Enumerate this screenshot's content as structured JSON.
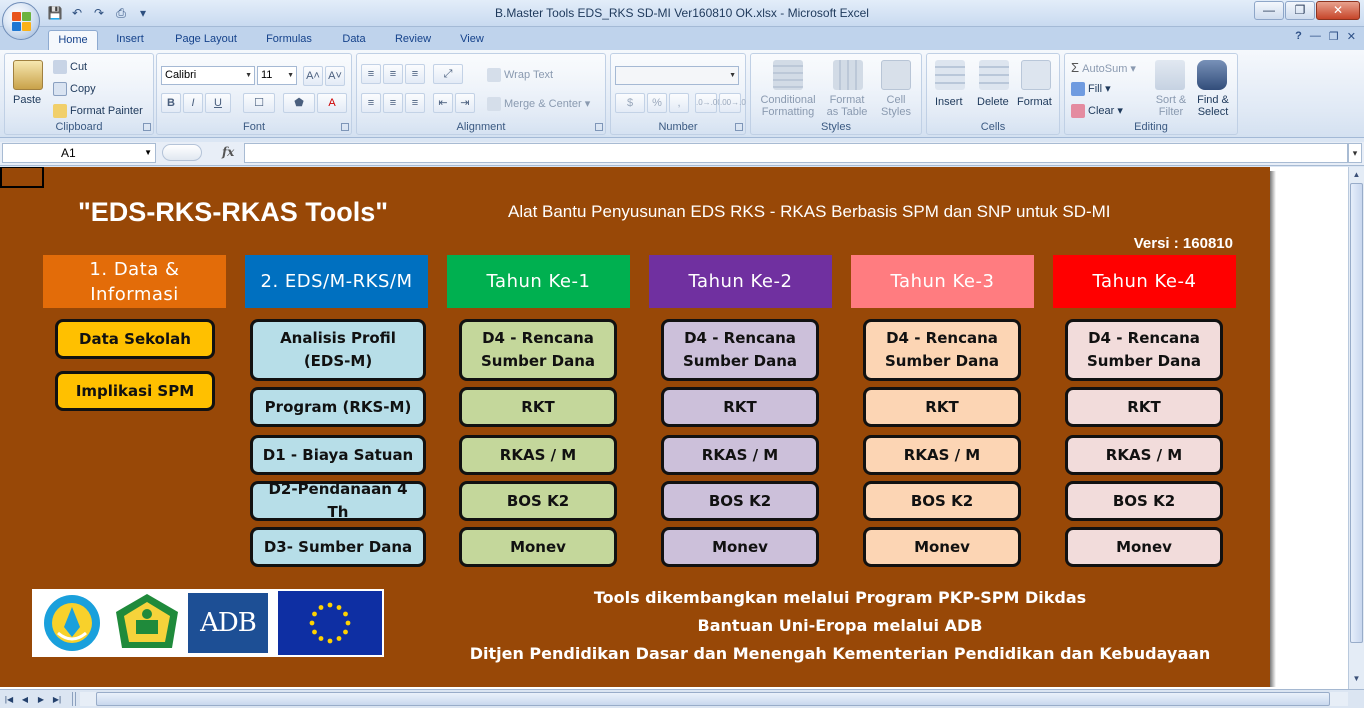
{
  "window": {
    "title": "B.Master Tools EDS_RKS SD-MI Ver160810 OK.xlsx - Microsoft Excel",
    "minimize": "—",
    "restore": "❐",
    "close": "✕"
  },
  "qat": {
    "save": "💾",
    "undo": "↶",
    "redo": "↷",
    "print": "⎙",
    "more": "▾"
  },
  "tabs": [
    {
      "label": "Home",
      "active": true
    },
    {
      "label": "Insert"
    },
    {
      "label": "Page Layout"
    },
    {
      "label": "Formulas"
    },
    {
      "label": "Data"
    },
    {
      "label": "Review"
    },
    {
      "label": "View"
    }
  ],
  "ribbon_ctl": {
    "help": "?",
    "min": "—",
    "restore": "❐",
    "close": "✕"
  },
  "ribbon": {
    "clipboard": {
      "label": "Clipboard",
      "paste": "Paste",
      "cut": "Cut",
      "copy": "Copy",
      "format_painter": "Format Painter"
    },
    "font": {
      "label": "Font",
      "font_name": "Calibri",
      "font_size": "11",
      "grow": "A˄",
      "shrink": "A˅",
      "bold": "B",
      "italic": "I",
      "underline": "U",
      "borders": "☐",
      "fill": "⬟",
      "color": "A"
    },
    "alignment": {
      "label": "Alignment",
      "wrap_text": "Wrap Text",
      "merge_center": "Merge & Center"
    },
    "number": {
      "label": "Number",
      "currency": "$",
      "percent": "%",
      "comma": ",",
      "inc": ".0→.00",
      "dec": ".00→.0"
    },
    "styles": {
      "label": "Styles",
      "conditional_formatting": [
        "Conditional",
        "Formatting"
      ],
      "format_as_table": [
        "Format",
        "as Table"
      ],
      "cell_styles": [
        "Cell",
        "Styles"
      ]
    },
    "cells": {
      "label": "Cells",
      "insert": "Insert",
      "delete": "Delete",
      "format": "Format"
    },
    "editing": {
      "label": "Editing",
      "autosum": "AutoSum",
      "fill": "Fill",
      "clear": "Clear",
      "sort_filter": [
        "Sort &",
        "Filter"
      ],
      "find_select": [
        "Find &",
        "Select"
      ]
    }
  },
  "formula_bar": {
    "name_box": "A1",
    "fx": "fx",
    "value": ""
  },
  "panel": {
    "title": "\"EDS-RKS-RKAS Tools\"",
    "subtitle": "Alat Bantu Penyusunan EDS RKS - RKAS Berbasis SPM dan SNP untuk SD-MI",
    "version": "Versi : 160810",
    "columns": [
      {
        "header": "1.  Data & Informasi",
        "header_color": "#e36c09",
        "button_color": "#ffc000",
        "buttons": [
          "Data  Sekolah",
          "Implikasi SPM"
        ]
      },
      {
        "header": "2.  EDS/M-RKS/M",
        "header_color": "#0070c0",
        "button_color": "#b7dee8",
        "buttons": [
          "Analisis Profil (EDS-M)",
          "Program (RKS-M)",
          "D1 - Biaya Satuan",
          "D2-Pendanaan 4 Th",
          "D3- Sumber Dana"
        ]
      },
      {
        "header": "Tahun Ke-1",
        "header_color": "#00b050",
        "button_color": "#c4d79b",
        "buttons": [
          "D4 - Rencana Sumber Dana",
          "RKT",
          "RKAS / M",
          "BOS K2",
          "Monev"
        ]
      },
      {
        "header": "Tahun Ke-2",
        "header_color": "#7030a0",
        "button_color": "#ccc0da",
        "buttons": [
          "D4 - Rencana Sumber Dana",
          "RKT",
          "RKAS / M",
          "BOS K2",
          "Monev"
        ]
      },
      {
        "header": "Tahun Ke-3",
        "header_color": "#ff7c80",
        "button_color": "#fcd5b4",
        "buttons": [
          "D4 - Rencana Sumber Dana",
          "RKT",
          "RKAS / M",
          "BOS K2",
          "Monev"
        ]
      },
      {
        "header": "Tahun Ke-4",
        "header_color": "#ff0000",
        "button_color": "#f2dcdb",
        "buttons": [
          "D4 - Rencana Sumber Dana",
          "RKT",
          "RKAS / M",
          "BOS K2",
          "Monev"
        ]
      }
    ],
    "credits": [
      "Tools dikembangkan melalui Program PKP-SPM Dikdas",
      "Bantuan Uni-Eropa melalui ADB",
      "Ditjen Pendidikan Dasar dan Menengah  Kementerian Pendidikan dan Kebudayaan"
    ],
    "logos": {
      "adb": "ADB"
    },
    "background": "#984807"
  }
}
